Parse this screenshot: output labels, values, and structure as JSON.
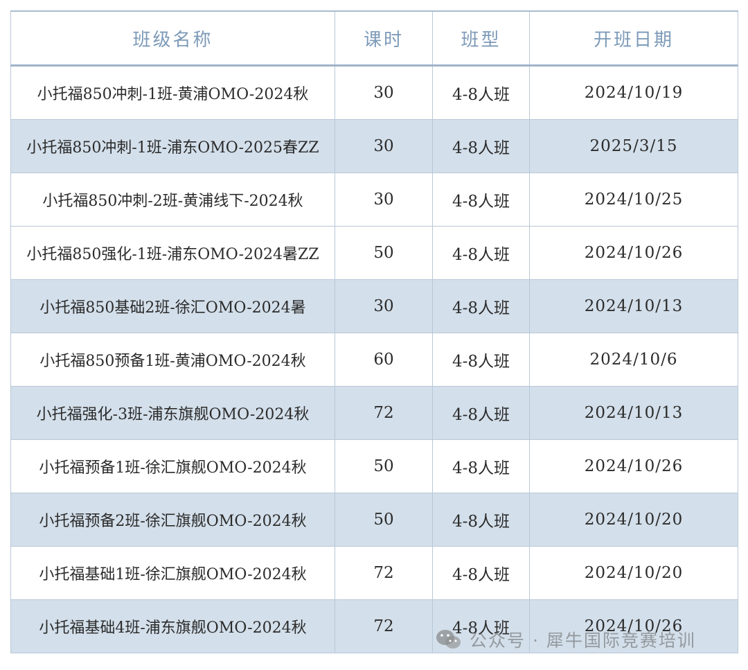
{
  "table": {
    "headers": [
      "班级名称",
      "课时",
      "班型",
      "开班日期"
    ],
    "rows": [
      [
        "小托福850冲刺-1班-黄浦OMO-2024秋",
        "30",
        "4-8人班",
        "2024/10/19"
      ],
      [
        "小托福850冲刺-1班-浦东OMO-2025春ZZ",
        "30",
        "4-8人班",
        "2025/3/15"
      ],
      [
        "小托福850冲刺-2班-黄浦线下-2024秋",
        "30",
        "4-8人班",
        "2024/10/25"
      ],
      [
        "小托福850强化-1班-浦东OMO-2024暑ZZ",
        "50",
        "4-8人班",
        "2024/10/26"
      ],
      [
        "小托福850基础2班-徐汇OMO-2024暑",
        "30",
        "4-8人班",
        "2024/10/13"
      ],
      [
        "小托福850预备1班-黄浦OMO-2024秋",
        "60",
        "4-8人班",
        "2024/10/6"
      ],
      [
        "小托福强化-3班-浦东旗舰OMO-2024秋",
        "72",
        "4-8人班",
        "2024/10/13"
      ],
      [
        "小托福预备1班-徐汇旗舰OMO-2024秋",
        "50",
        "4-8人班",
        "2024/10/26"
      ],
      [
        "小托福预备2班-徐汇旗舰OMO-2024秋",
        "50",
        "4-8人班",
        "2024/10/20"
      ],
      [
        "小托福基础1班-徐汇旗舰OMO-2024秋",
        "72",
        "4-8人班",
        "2024/10/20"
      ],
      [
        "小托福基础4班-浦东旗舰OMO-2024秋",
        "72",
        "4-8人班",
        "2024/10/26"
      ]
    ]
  },
  "watermark": {
    "text": "公众号 · 犀牛国际竞赛培训",
    "icon": "wechat-icon"
  },
  "colors": {
    "header_text": "#7d9ab8",
    "row_alt_bg": "#d3dfea",
    "border": "#b8c8d8",
    "body_text": "#2b2b2b"
  }
}
